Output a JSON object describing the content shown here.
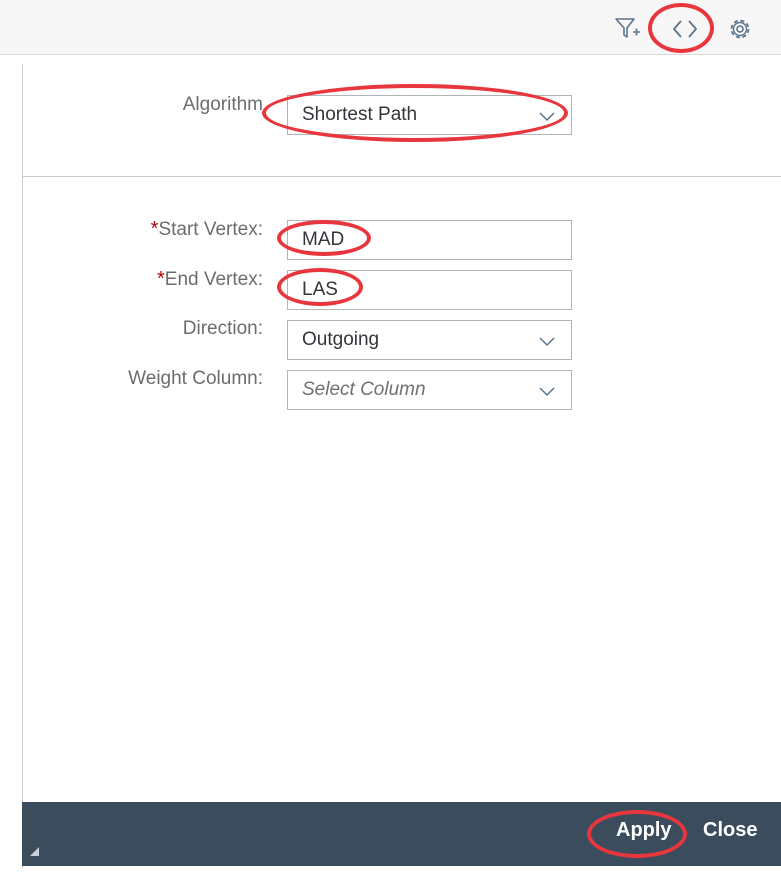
{
  "toolbar": {
    "icons": [
      "add-filter-icon",
      "code-view-icon",
      "settings-gear-icon"
    ]
  },
  "algorithm": {
    "label": "Algorithm",
    "value": "Shortest Path"
  },
  "form": {
    "required_marker": "*",
    "start_vertex": {
      "label": "Start Vertex:",
      "value": "MAD"
    },
    "end_vertex": {
      "label": "End Vertex:",
      "value": "LAS"
    },
    "direction": {
      "label": "Direction:",
      "value": "Outgoing"
    },
    "weight_column": {
      "label": "Weight Column:",
      "placeholder": "Select Column"
    }
  },
  "footer": {
    "apply_label": "Apply",
    "close_label": "Close"
  },
  "colors": {
    "footer_bg": "#3b4c5c",
    "highlight_ring": "#e8363f",
    "required": "#bb0000"
  }
}
